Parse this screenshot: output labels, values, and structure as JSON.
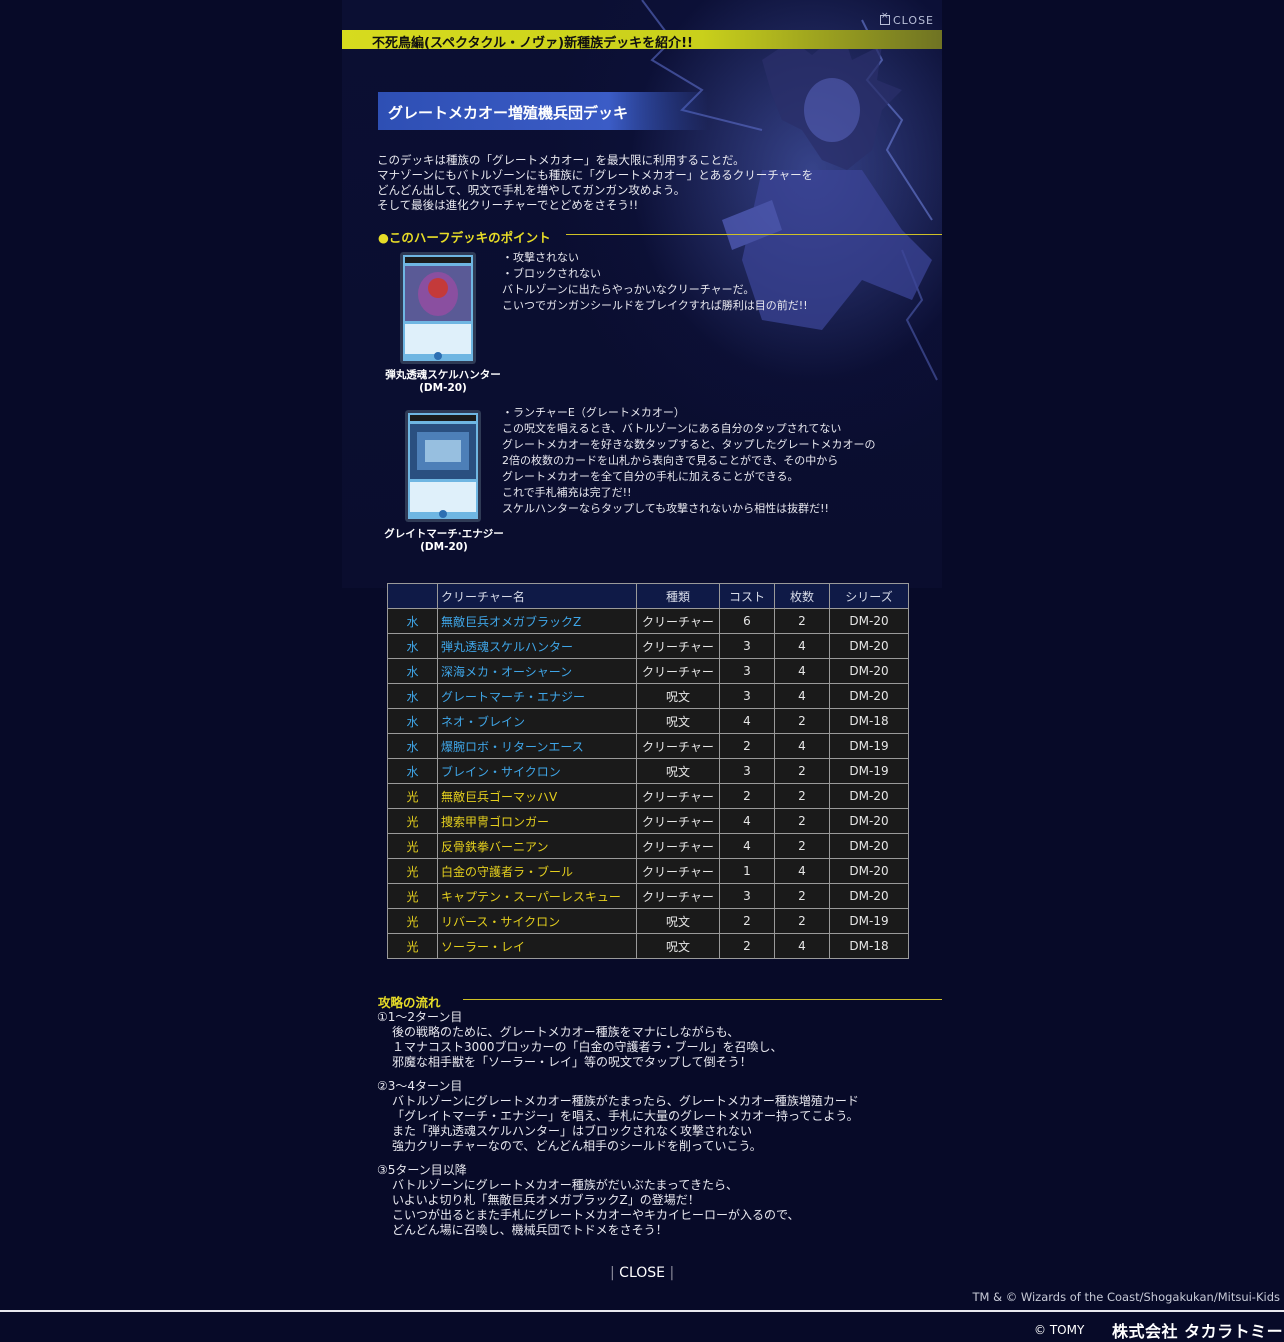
{
  "close_top": "CLOSE",
  "header_banner": "不死鳥編(スペクタクル・ノヴァ)新種族デッキを紹介!!",
  "deck_title": "グレートメカオー増殖機兵団デッキ",
  "intro_lines": [
    "このデッキは種族の「グレートメカオー」を最大限に利用することだ。",
    "マナゾーンにもバトルゾーンにも種族に「グレートメカオー」とあるクリーチャーを",
    "どんどん出して、呪文で手札を増やしてガンガン攻めよう。",
    "そして最後は進化クリーチャーでとどめをさそう!!"
  ],
  "points_heading": "●このハーフデッキのポイント",
  "cards": [
    {
      "name": "弾丸透魂スケルハンター",
      "set": "(DM-20)",
      "desc": [
        "・攻撃されない",
        "・ブロックされない",
        "バトルゾーンに出たらやっかいなクリーチャーだ。",
        "こいつでガンガンシールドをブレイクすれば勝利は目の前だ!!"
      ]
    },
    {
      "name": "グレイトマーチ·エナジー",
      "set": "(DM-20)",
      "desc": [
        "・ランチャーE（グレートメカオー）",
        "この呪文を唱えるとき、バトルゾーンにある自分のタップされてない",
        "グレートメカオーを好きな数タップすると、タップしたグレートメカオーの",
        "2倍の枚数のカードを山札から表向きで見ることができ、その中から",
        "グレートメカオーを全て自分の手札に加えることができる。",
        "これで手札補充は完了だ!!",
        "スケルハンターならタップしても攻撃されないから相性は抜群だ!!"
      ]
    }
  ],
  "table": {
    "headers": [
      "",
      "クリーチャー名",
      "種類",
      "コスト",
      "枚数",
      "シリーズ"
    ],
    "rows": [
      {
        "civ": "水",
        "name": "無敵巨兵オメガブラックZ",
        "type": "クリーチャー",
        "cost": "6",
        "count": "2",
        "series": "DM-20"
      },
      {
        "civ": "水",
        "name": "弾丸透魂スケルハンター",
        "type": "クリーチャー",
        "cost": "3",
        "count": "4",
        "series": "DM-20"
      },
      {
        "civ": "水",
        "name": "深海メカ・オーシャーン",
        "type": "クリーチャー",
        "cost": "3",
        "count": "4",
        "series": "DM-20"
      },
      {
        "civ": "水",
        "name": "グレートマーチ・エナジー",
        "type": "呪文",
        "cost": "3",
        "count": "4",
        "series": "DM-20"
      },
      {
        "civ": "水",
        "name": "ネオ・ブレイン",
        "type": "呪文",
        "cost": "4",
        "count": "2",
        "series": "DM-18"
      },
      {
        "civ": "水",
        "name": "爆腕ロボ・リターンエース",
        "type": "クリーチャー",
        "cost": "2",
        "count": "4",
        "series": "DM-19"
      },
      {
        "civ": "水",
        "name": "ブレイン・サイクロン",
        "type": "呪文",
        "cost": "3",
        "count": "2",
        "series": "DM-19"
      },
      {
        "civ": "光",
        "name": "無敵巨兵ゴーマッハV",
        "type": "クリーチャー",
        "cost": "2",
        "count": "2",
        "series": "DM-20"
      },
      {
        "civ": "光",
        "name": "捜索甲冑ゴロンガー",
        "type": "クリーチャー",
        "cost": "4",
        "count": "2",
        "series": "DM-20"
      },
      {
        "civ": "光",
        "name": "反骨鉄拳バーニアン",
        "type": "クリーチャー",
        "cost": "4",
        "count": "2",
        "series": "DM-20"
      },
      {
        "civ": "光",
        "name": "白金の守護者ラ・ブール",
        "type": "クリーチャー",
        "cost": "1",
        "count": "4",
        "series": "DM-20"
      },
      {
        "civ": "光",
        "name": "キャプテン・スーパーレスキュー",
        "type": "クリーチャー",
        "cost": "3",
        "count": "2",
        "series": "DM-20"
      },
      {
        "civ": "光",
        "name": "リバース・サイクロン",
        "type": "呪文",
        "cost": "2",
        "count": "2",
        "series": "DM-19"
      },
      {
        "civ": "光",
        "name": "ソーラー・レイ",
        "type": "呪文",
        "cost": "2",
        "count": "4",
        "series": "DM-18"
      }
    ]
  },
  "flow_heading": "攻略の流れ",
  "flow": [
    {
      "title": "①1〜2ターン目",
      "lines": [
        "後の戦略のために、グレートメカオー種族をマナにしながらも、",
        "１マナコスト3000ブロッカーの「白金の守護者ラ・ブール」を召喚し、",
        "邪魔な相手獣を「ソーラー・レイ」等の呪文でタップして倒そう！"
      ]
    },
    {
      "title": "②3〜4ターン目",
      "lines": [
        "バトルゾーンにグレートメカオー種族がたまったら、グレートメカオー種族増殖カード",
        "「グレイトマーチ・エナジー」を唱え、手札に大量のグレートメカオー持ってこよう。",
        "また「弾丸透魂スケルハンター」はブロックされなく攻撃されない",
        "強力クリーチャーなので、どんどん相手のシールドを削っていこう。"
      ]
    },
    {
      "title": "③5ターン目以降",
      "lines": [
        "バトルゾーンにグレートメカオー種族がだいぶたまってきたら、",
        "いよいよ切り札「無敵巨兵オメガブラックZ」の登場だ！",
        "こいつが出るとまた手札にグレートメカオーやキカイヒーローが入るので、",
        "どんどん場に召喚し、機械兵団でトドメをさそう！"
      ]
    }
  ],
  "close_bottom": {
    "left": "|",
    "label": "CLOSE",
    "right": "|"
  },
  "copyright": "TM & © Wizards of the Coast/Shogakukan/Mitsui-Kids",
  "footer": {
    "tomy": "© TOMY",
    "takara": "株式会社 タカラトミー"
  },
  "colors": {
    "water": "#3fa6e8",
    "light": "#e4cf1e",
    "accent_yellow": "#d7db1e",
    "title_blue": "#2e4fb4"
  }
}
